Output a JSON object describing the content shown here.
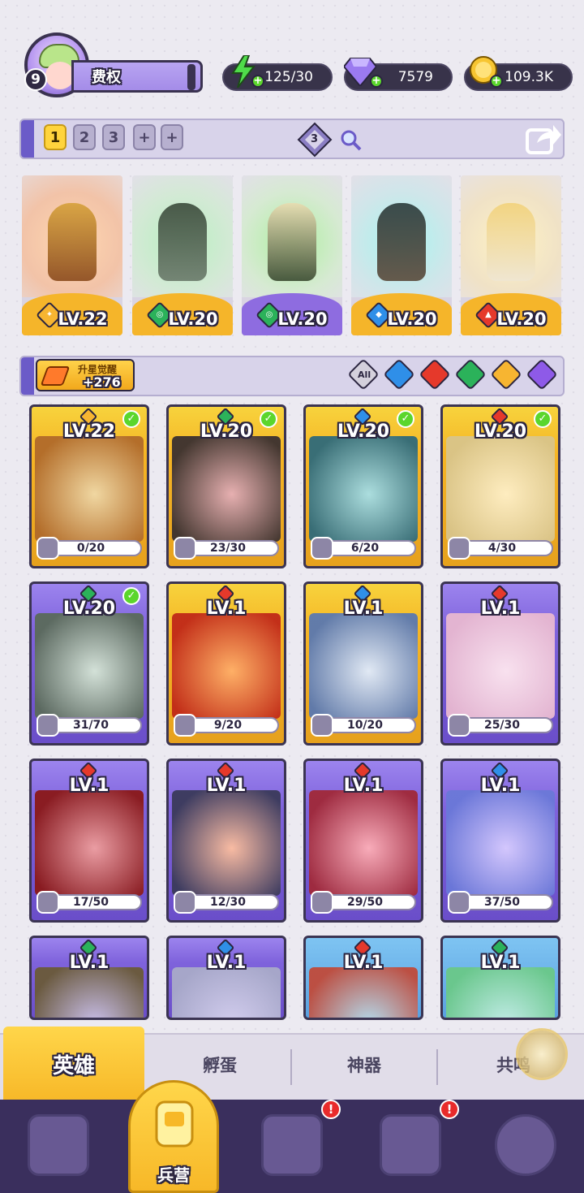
{
  "profile": {
    "level": "9",
    "name": "费权"
  },
  "resources": {
    "energy": {
      "value": "125/30",
      "icon": "lightning-icon",
      "color": "#4fdc4a"
    },
    "gems": {
      "value": "7579",
      "icon": "gem-icon",
      "color": "#9b7af0"
    },
    "coins": {
      "value": "109.3K",
      "icon": "coin-icon",
      "color": "#f7c531"
    }
  },
  "team": {
    "slots": [
      "1",
      "2",
      "3"
    ],
    "active_slot": "1",
    "power_badge": "3",
    "formation": [
      {
        "level": "LV.22",
        "element": "gold",
        "color": "#f7b531"
      },
      {
        "level": "LV.20",
        "element": "green",
        "color": "#2bb25a"
      },
      {
        "level": "LV.20",
        "element": "green",
        "color": "#2bb25a"
      },
      {
        "level": "LV.20",
        "element": "blue",
        "color": "#2f8fe8"
      },
      {
        "level": "LV.20",
        "element": "red",
        "color": "#e5392b"
      }
    ]
  },
  "filter": {
    "awaken_label": "升星觉醒",
    "awaken_value": "+276",
    "all_label": "All",
    "elements": [
      "water",
      "fire",
      "wind",
      "light",
      "dark"
    ]
  },
  "heroes": [
    {
      "level": "LV.22",
      "progress": "0/20",
      "rarity": "gold",
      "element": "gold",
      "ready": true
    },
    {
      "level": "LV.20",
      "progress": "23/30",
      "rarity": "gold",
      "element": "green",
      "ready": true
    },
    {
      "level": "LV.20",
      "progress": "6/20",
      "rarity": "gold",
      "element": "blue",
      "ready": true
    },
    {
      "level": "LV.20",
      "progress": "4/30",
      "rarity": "gold",
      "element": "red",
      "ready": true
    },
    {
      "level": "LV.20",
      "progress": "31/70",
      "rarity": "purple",
      "element": "green",
      "ready": true
    },
    {
      "level": "LV.1",
      "progress": "9/20",
      "rarity": "gold",
      "element": "red",
      "ready": false
    },
    {
      "level": "LV.1",
      "progress": "10/20",
      "rarity": "gold",
      "element": "blue",
      "ready": false
    },
    {
      "level": "LV.1",
      "progress": "25/30",
      "rarity": "purple",
      "element": "red",
      "ready": false
    },
    {
      "level": "LV.1",
      "progress": "17/50",
      "rarity": "purple",
      "element": "red",
      "ready": false
    },
    {
      "level": "LV.1",
      "progress": "12/30",
      "rarity": "purple",
      "element": "red",
      "ready": false
    },
    {
      "level": "LV.1",
      "progress": "29/50",
      "rarity": "purple",
      "element": "red",
      "ready": false
    },
    {
      "level": "LV.1",
      "progress": "37/50",
      "rarity": "purple",
      "element": "blue",
      "ready": false
    },
    {
      "level": "LV.1",
      "progress": "",
      "rarity": "purple",
      "element": "green",
      "ready": false
    },
    {
      "level": "LV.1",
      "progress": "",
      "rarity": "purple",
      "element": "blue",
      "ready": false
    },
    {
      "level": "LV.1",
      "progress": "",
      "rarity": "blue",
      "element": "red",
      "ready": false
    },
    {
      "level": "LV.1",
      "progress": "",
      "rarity": "blue",
      "element": "green",
      "ready": false
    }
  ],
  "tabs": {
    "heroes": "英雄",
    "hatch": "孵蛋",
    "artifacts": "神器",
    "resonance": "共鸣"
  },
  "nav": {
    "barracks_label": "兵营",
    "badge_1": "!",
    "badge_2": "!"
  }
}
